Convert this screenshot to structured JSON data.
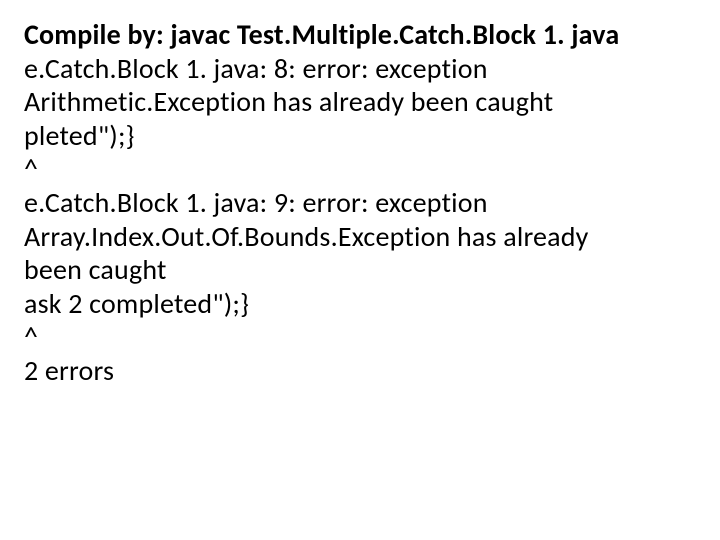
{
  "lines": {
    "l0": "Compile by: javac Test.Multiple.Catch.Block 1. java",
    "l1": "e.Catch.Block 1. java: 8: error: exception",
    "l2": "Arithmetic.Exception has already been caught",
    "l3": "pleted\");}",
    "l4": "^",
    "l5": "e.Catch.Block 1. java: 9: error: exception",
    "l6": "Array.Index.Out.Of.Bounds.Exception has already",
    "l7": "been caught",
    "l8": "ask 2 completed\");}",
    "l9": "^",
    "l10": "2 errors"
  }
}
